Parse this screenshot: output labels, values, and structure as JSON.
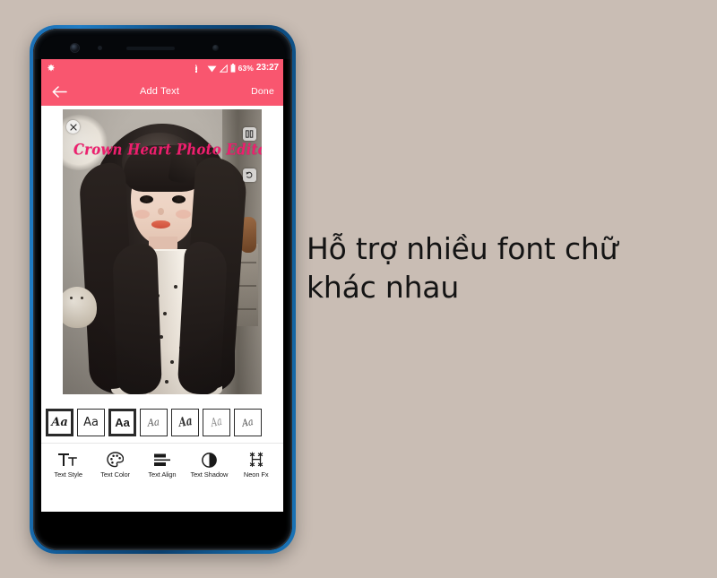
{
  "background_color": "#c9bdb4",
  "caption": {
    "text": "Hỗ trợ nhiều font chữ khác nhau"
  },
  "phone": {
    "bezel_color": "#1565a8",
    "body_color": "#000000"
  },
  "statusbar": {
    "background_color": "#f9566f",
    "cast_icon": "screen-cast-icon",
    "wifi_icon": "wifi-icon",
    "signal_icon": "signal-icon",
    "battery_icon": "battery-icon",
    "battery_percent": "63%",
    "time": "23:27",
    "notification_icon": "app-notification-icon"
  },
  "appbar": {
    "background_color": "#f9566f",
    "back_icon": "back-arrow-icon",
    "title": "Add Text",
    "done_label": "Done"
  },
  "canvas": {
    "overlay_text": "Crown Heart Photo Editor",
    "overlay_text_color": "#ee1f6e",
    "handles": {
      "close": "close-icon",
      "edit": "edit-text-icon",
      "resize": "resize-rotate-icon"
    }
  },
  "font_strip": {
    "tiles": [
      {
        "sample": "Aa",
        "style": "serif-italic-bold",
        "selected": true
      },
      {
        "sample": "Aa",
        "style": "sans-light",
        "selected": false
      },
      {
        "sample": "Aa",
        "style": "sans-bold",
        "selected": true
      },
      {
        "sample": "Aa",
        "style": "script-thin",
        "selected": false
      },
      {
        "sample": "Aa",
        "style": "script-bold",
        "selected": false
      },
      {
        "sample": "Aa",
        "style": "script-light",
        "selected": false
      },
      {
        "sample": "Aa",
        "style": "script-fine",
        "selected": false
      }
    ]
  },
  "toolbar": {
    "items": [
      {
        "label": "Text Style",
        "icon": "text-style-icon"
      },
      {
        "label": "Text Color",
        "icon": "color-palette-icon"
      },
      {
        "label": "Text Align",
        "icon": "text-align-icon"
      },
      {
        "label": "Text Shadow",
        "icon": "shadow-contrast-icon"
      },
      {
        "label": "Neon Fx",
        "icon": "neon-sparkle-icon"
      }
    ]
  }
}
